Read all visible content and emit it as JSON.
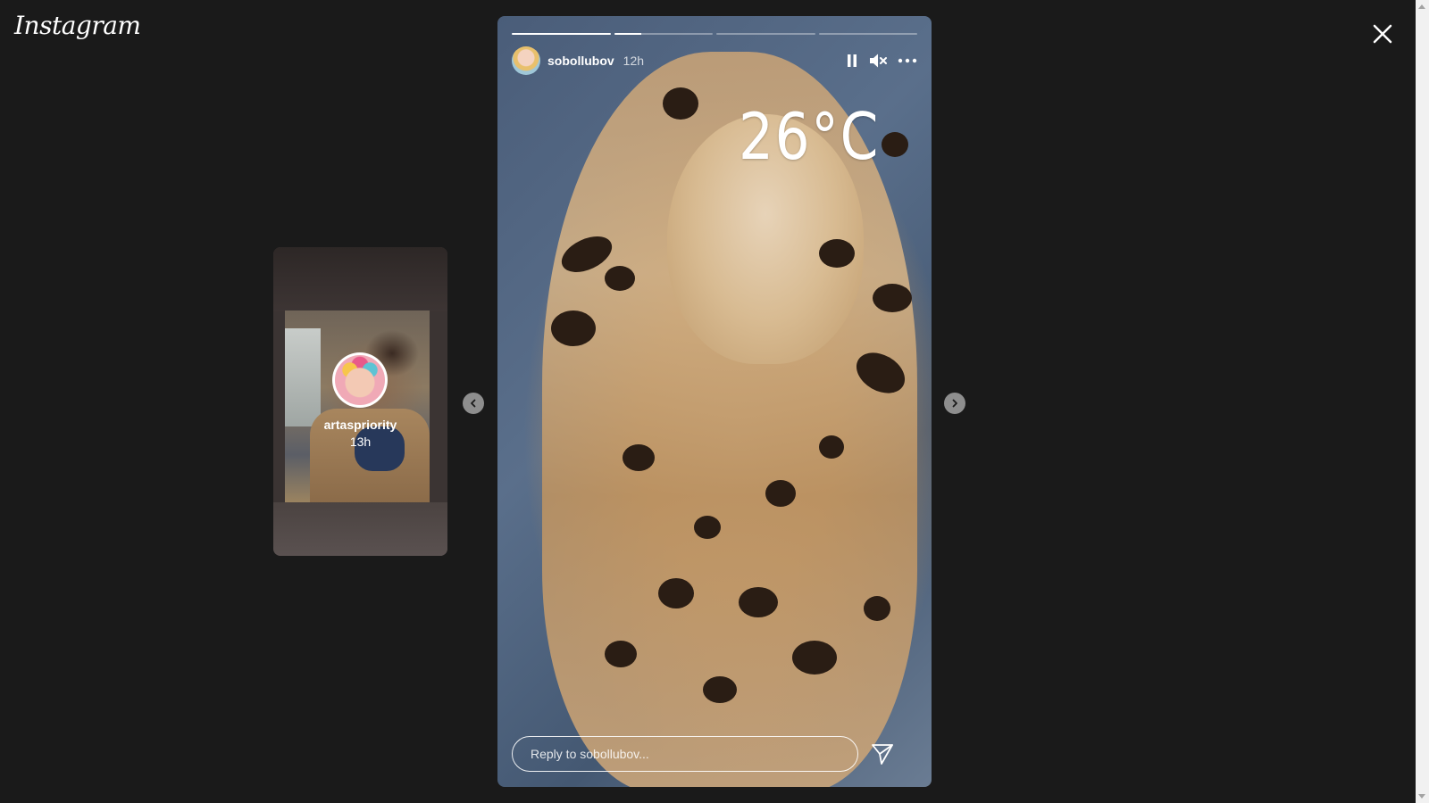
{
  "app": {
    "logo_text": "Instagram"
  },
  "preview": {
    "username": "artaspriority",
    "time": "13h"
  },
  "story": {
    "username": "sobollubov",
    "time": "12h",
    "sticker_text": "26°C",
    "progress_segments": [
      1,
      0.28,
      0,
      0
    ],
    "reply_placeholder": "Reply to sobollubov..."
  },
  "icons": {
    "close": "close-icon",
    "pause": "pause-icon",
    "mute": "muted-speaker-icon",
    "more": "more-options-icon",
    "send": "send-icon",
    "prev": "chevron-left-icon",
    "next": "chevron-right-icon"
  },
  "colors": {
    "background": "#1a1a1a",
    "nav_button": "#8e8e8e"
  }
}
